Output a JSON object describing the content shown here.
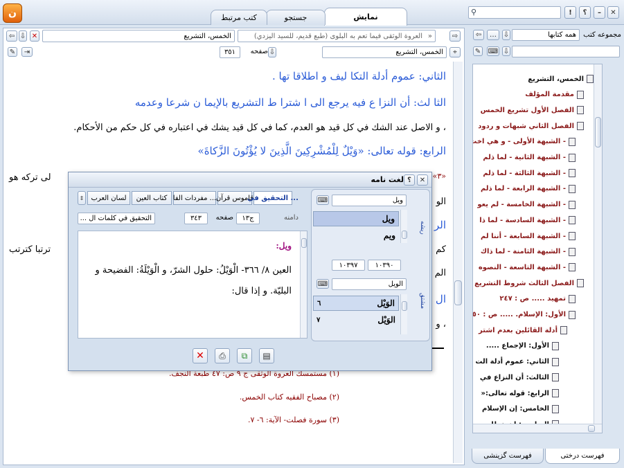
{
  "titlebar": {
    "tabs": [
      "نمایش",
      "جستجو",
      "کتب مرتبط"
    ],
    "search_placeholder": ""
  },
  "main": {
    "book_title": "العروة الوثقى فيما تعم به البلوى (طبع قديم، للسيد اليزدي)",
    "section_field": "الخمس، التشريع",
    "section_combo": "الخمس، التشريع",
    "page_label": "صفحه",
    "page_value": "٣٥١",
    "lines": [
      "الثاني: عموم أدلة التكا ليف و اطلاقا تها .",
      "الثا لث: أن النزا ع فيه يرجع الى ا شترا ط التشريع بالإيما ن شرعا وعدمه",
      "، و الاصل عند الشك في كل قيد هو العدم، كما في كل قيد يشك في اعتباره في كل حكم من الأحكام.",
      "الرابع: قوله تعالى: «وَيْلٌ لِلْمُشْرِكِينَ الَّذِينَ لا يُؤْتُونَ الزَّكاةَ»"
    ],
    "partial_right": [
      "«٣»",
      "الو",
      "الر",
      "كم",
      "الم",
      "ال",
      "، و"
    ],
    "partial_left": [
      "لى تركه هو",
      "ترتبا كترتب"
    ],
    "footnotes": [
      "(١) مستمسك العروة الوثقى ج ٩ ص: ٤٧ طبعة النجف.",
      "(٢) مصباح الفقيه كتاب الخمس.",
      "(٣) سورة فصلت- الآية: ٦- ٧."
    ]
  },
  "side": {
    "collection_label": "مجموعه كتب",
    "collection_value": "همه كتابها",
    "tree": [
      {
        "label": "الخمس، التشريع",
        "dark": true
      },
      {
        "label": "مقدمة المؤلف",
        "dark": false
      },
      {
        "label": "الفصل الأول تشريع الخمس",
        "dark": false
      },
      {
        "label": "الفصل الثاني شبهات و ردود",
        "dark": false
      },
      {
        "label": "- الشبهة الأولى - و هي اخت",
        "dark": false
      },
      {
        "label": "- الشبهة الثانية - لما ذلم",
        "dark": false
      },
      {
        "label": "- الشبهة الثالثة - لما ذلم",
        "dark": false
      },
      {
        "label": "- الشبهة الرابعة - لما ذلم",
        "dark": false
      },
      {
        "label": "- الشبهة الخامسة - لم يعو",
        "dark": false
      },
      {
        "label": "- الشبهة السادسة - لما ذا",
        "dark": false
      },
      {
        "label": "- الشبهة السابعة - أننا لم",
        "dark": false
      },
      {
        "label": "- الشبهة الثامنة - لما ذاك",
        "dark": false
      },
      {
        "label": "- الشبهة التاسعة - النصوه",
        "dark": false
      },
      {
        "label": "الفصل الثالث شروط التشريع",
        "dark": false
      },
      {
        "label": "تمهيد ..... ص : ٢٤٧",
        "dark": false
      },
      {
        "label": "الأول: الإسلام. ..... ص : ٥٠",
        "dark": false
      },
      {
        "label": "أدلة القائلين بعدم اشتر",
        "dark": false
      },
      {
        "label": "الأول: الإجماع .....",
        "dark": true
      },
      {
        "label": "الثاني: عموم أدلة الت",
        "dark": true
      },
      {
        "label": "الثالث: أن النزاع في",
        "dark": true
      },
      {
        "label": "الرابع: قوله تعالى:«",
        "dark": true
      },
      {
        "label": "الخامس: إن الإسلام",
        "dark": true
      },
      {
        "label": "السادس: إن خطاب",
        "dark": true
      }
    ],
    "bottom_tabs": [
      "فهرست درختی",
      "فهرست گزينشی"
    ]
  },
  "dialog": {
    "title": "لغت نامه",
    "dict_tabs": [
      "التحقيق في ...",
      "قاموس قرآن",
      "مفردات الفا ...",
      "كتاب العين",
      "لسان العرب"
    ],
    "source_label": "التحقيق في كلمات ال ...",
    "page_label": "صفحه",
    "page_value": "٣٤٣",
    "vol_value": "ج١٣",
    "scope_label": "دامنه",
    "root_side": "ريشه",
    "word_side": "مشتق",
    "root_input": "ويل",
    "root_list": [
      "ويل",
      "ويم"
    ],
    "range_from": "١٠٣٩٠",
    "range_to": "١٠٣٩٧",
    "word_input": "الويل",
    "word_list": [
      {
        "word": "الوَيْل",
        "count": "٦"
      },
      {
        "word": "الوَيْل",
        "count": "٧"
      }
    ],
    "entry_head": "ويل:",
    "entry_body": "العين ٨/ ٣٦٦- الْوَيْلُ: حلول الشرّ، و الْوَيْلَةُ: الفضيحة و البليّة. و إذا قال:"
  },
  "colors": {
    "accent_blue": "#2a5bd7",
    "tree_red": "#8b1a1a",
    "frame": "#dbe5f1"
  }
}
